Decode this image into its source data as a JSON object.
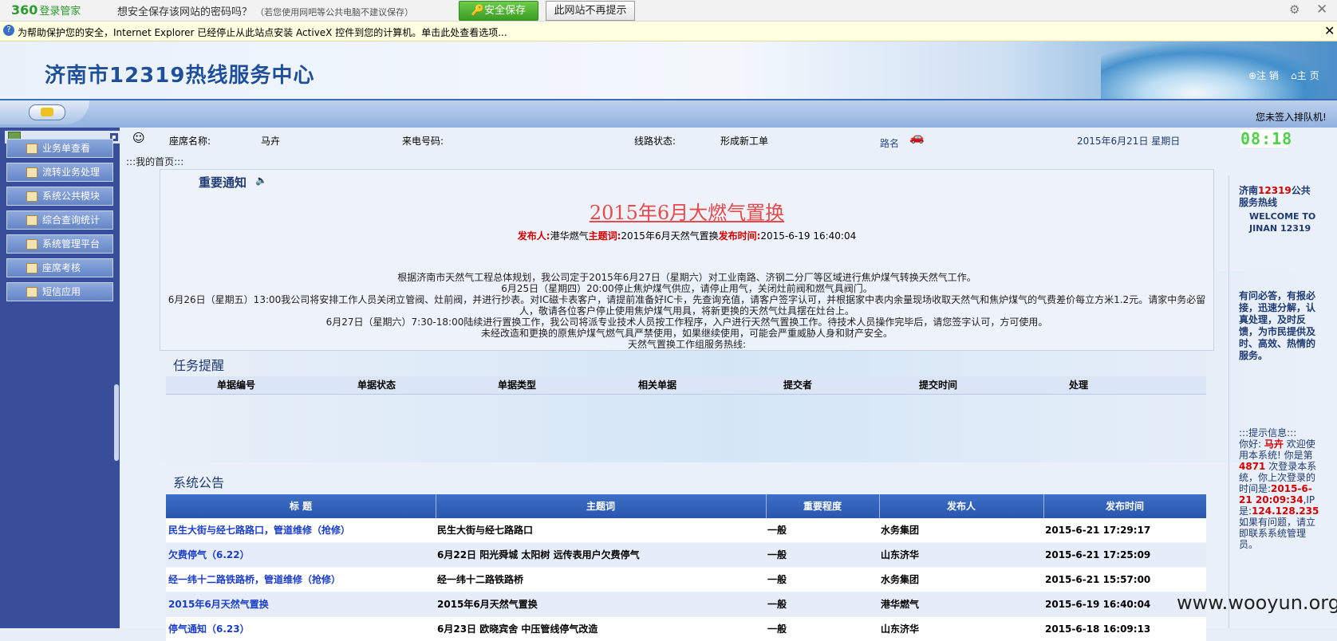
{
  "bar360": {
    "logo": "360",
    "logo_sub": "登录管家",
    "question": "想安全保存该网站的密码吗？",
    "hint": "（若您使用网吧等公共电脑不建议保存）",
    "save_btn": "安全保存",
    "never_btn": "此网站不再提示",
    "gear_icon": "gear-icon",
    "close_icon": "close-icon"
  },
  "infobar": {
    "text": "为帮助保护您的安全，Internet Explorer 已经停止从此站点安装 ActiveX 控件到您的计算机。单击此处查看选项..."
  },
  "header": {
    "title": "济南市12319热线服务中心",
    "logout": "注 销",
    "home": "主 页",
    "status": "您未签入排队机!"
  },
  "sidebar": {
    "items": [
      {
        "label": "业务单查看"
      },
      {
        "label": "流转业务处理"
      },
      {
        "label": "系统公共模块"
      },
      {
        "label": "综合查询统计"
      },
      {
        "label": "系统管理平台"
      },
      {
        "label": "座席考核"
      },
      {
        "label": "短信应用"
      }
    ]
  },
  "info": {
    "seat_label": "座席名称:",
    "seat_name": "马卉",
    "phone_label": "来电号码:",
    "line_label": "线路状态:",
    "line_status": "形成新工单",
    "road": "路名",
    "date": "2015年6月21日  星期日",
    "clock": "08:18"
  },
  "breadcrumb": ":::我的首页:::",
  "notice": {
    "heading": "重要通知",
    "title": "2015年6月大燃气置换",
    "publisher_label": "发布人:",
    "publisher": "港华燃气",
    "subject_label": "主题词:",
    "subject": "2015年6月天然气置换",
    "time_label": "发布时间:",
    "time": "2015-6-19  16:40:04",
    "lines": [
      "根据济南市天然气工程总体规划，我公司定于2015年6月27日（星期六）对工业南路、济钢二分厂等区域进行焦炉煤气转换天然气工作。",
      "6月25日（星期四）20:00停止焦炉煤气供应，请停止用气，关闭灶前阀和燃气具阀门。",
      "6月26日（星期五）13:00我公司将安排工作人员关闭立管阀、灶前阀，并进行抄表。对IC磁卡表客户，请提前准备好IC卡，先查询充值，请客户签字认可，并根据家中表内余量现场收取天然气和焦炉煤气的气费差价每立方米1.2元。请家中务必留人，敬请各位客户停止使用焦炉煤气用具，将新更换的天然气灶具摆在灶台上。",
      "6月27日（星期六）7:30-18:00陆续进行置换工作，我公司将派专业技术人员按工作程序，入户进行天然气置换工作。待技术人员操作完毕后，请您签字认可，方可使用。",
      "未经改造和更换的原焦炉煤气燃气具严禁使用，如果继续使用，可能会严重威胁人身和财产安全。",
      "天然气置换工作组服务热线:"
    ]
  },
  "tasks": {
    "heading": "任务提醒",
    "columns": [
      "单据编号",
      "单据状态",
      "单据类型",
      "相关单据",
      "提交者",
      "提交时间",
      "处理"
    ]
  },
  "announcements": {
    "heading": "系统公告",
    "columns": [
      "标 题",
      "主题词",
      "重要程度",
      "发布人",
      "发布时间"
    ],
    "rows": [
      [
        "民生大街与经七路路口，管道维修（抢修）",
        "民生大街与经七路路口",
        "一般",
        "水务集团",
        "2015-6-21  17:29:17"
      ],
      [
        "欠费停气（6.22）",
        "6月22日 阳光舜城 太阳树 远传表用户欠费停气",
        "一般",
        "山东济华",
        "2015-6-21  17:25:09"
      ],
      [
        "经一纬十二路铁路桥，管道维修（抢修）",
        "经一纬十二路铁路桥",
        "一般",
        "水务集团",
        "2015-6-21  15:57:00"
      ],
      [
        "2015年6月天然气置换",
        "2015年6月天然气置换",
        "一般",
        "港华燃气",
        "2015-6-19  16:40:04"
      ],
      [
        "停气通知（6.23）",
        "6月23日 欧晓宾舍 中压管线停气改造",
        "一般",
        "山东济华",
        "2015-6-18  16:09:13"
      ]
    ]
  },
  "right_panel": {
    "line1_a": "济南",
    "line1_b": "12319",
    "line1_c": "公共服务热线",
    "welcome": "WELCOME TO JINAN 12319",
    "motto": "有问必答，有报必接，迅速分解，认真处理，及时反馈，为市民提供及时、高效、热情的服务。",
    "tip_heading": ":::提示信息:::",
    "greet_a": "你好:",
    "user": "马卉",
    "greet_b": "欢迎使用本系统!",
    "count_a": "你是第",
    "count": "4871",
    "count_b": "次登录本系统，你上次登录的时间是:",
    "last_time": "2015-6-21 20:09:34",
    "ip_label": ",IP是:",
    "ip": "124.128.235",
    "contact": "如果有问题，请立即联系系统管理员。"
  },
  "watermark": "www.wooyun.org"
}
